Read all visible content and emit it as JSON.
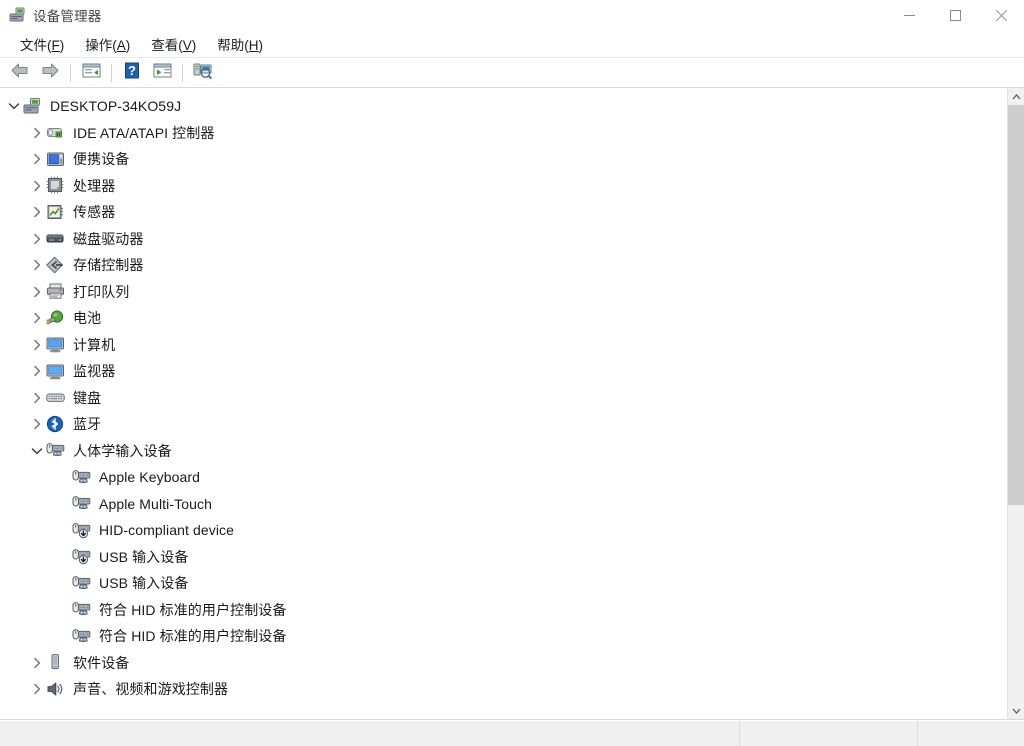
{
  "window": {
    "title": "设备管理器",
    "title_icon": "device-manager-icon",
    "controls": {
      "minimize": "最小化",
      "maximize": "最大化",
      "close": "关闭"
    }
  },
  "menubar": {
    "items": [
      {
        "label": "文件(F)",
        "pre": "文件(",
        "accel": "F",
        "post": ")"
      },
      {
        "label": "操作(A)",
        "pre": "操作(",
        "accel": "A",
        "post": ")"
      },
      {
        "label": "查看(V)",
        "pre": "查看(",
        "accel": "V",
        "post": ")"
      },
      {
        "label": "帮助(H)",
        "pre": "帮助(",
        "accel": "H",
        "post": ")"
      }
    ]
  },
  "toolbar": {
    "buttons": [
      {
        "name": "back-arrow-icon",
        "tooltip": "后退"
      },
      {
        "name": "forward-arrow-icon",
        "tooltip": "前进"
      },
      {
        "name": "show-hide-console-tree-icon",
        "tooltip": "显示/隐藏控制台树"
      },
      {
        "name": "help-icon",
        "tooltip": "帮助"
      },
      {
        "name": "properties-icon",
        "tooltip": "属性"
      },
      {
        "name": "scan-hardware-changes-icon",
        "tooltip": "扫描检测硬件改动"
      }
    ]
  },
  "tree": {
    "root": {
      "label": "DESKTOP-34KO59J",
      "icon": "computer-root-icon",
      "expanded": true
    },
    "items": [
      {
        "label": "IDE ATA/ATAPI 控制器",
        "icon": "ide-controller-icon",
        "level": 1,
        "expanded": false
      },
      {
        "label": "便携设备",
        "icon": "portable-device-icon",
        "level": 1,
        "expanded": false
      },
      {
        "label": "处理器",
        "icon": "processor-icon",
        "level": 1,
        "expanded": false
      },
      {
        "label": "传感器",
        "icon": "sensor-icon",
        "level": 1,
        "expanded": false
      },
      {
        "label": "磁盘驱动器",
        "icon": "disk-drive-icon",
        "level": 1,
        "expanded": false
      },
      {
        "label": "存储控制器",
        "icon": "storage-controller-icon",
        "level": 1,
        "expanded": false
      },
      {
        "label": "打印队列",
        "icon": "print-queue-icon",
        "level": 1,
        "expanded": false
      },
      {
        "label": "电池",
        "icon": "battery-icon",
        "level": 1,
        "expanded": false
      },
      {
        "label": "计算机",
        "icon": "computer-icon",
        "level": 1,
        "expanded": false
      },
      {
        "label": "监视器",
        "icon": "monitor-icon",
        "level": 1,
        "expanded": false
      },
      {
        "label": "键盘",
        "icon": "keyboard-icon",
        "level": 1,
        "expanded": false
      },
      {
        "label": "蓝牙",
        "icon": "bluetooth-icon",
        "level": 1,
        "expanded": false
      },
      {
        "label": "人体学输入设备",
        "icon": "hid-icon",
        "level": 1,
        "expanded": true
      },
      {
        "label": "Apple Keyboard",
        "icon": "hid-device-icon",
        "level": 2,
        "expanded": null
      },
      {
        "label": "Apple Multi-Touch",
        "icon": "hid-device-icon",
        "level": 2,
        "expanded": null
      },
      {
        "label": "HID-compliant device",
        "icon": "hid-device-download-icon",
        "level": 2,
        "expanded": null
      },
      {
        "label": "USB 输入设备",
        "icon": "hid-device-download-icon",
        "level": 2,
        "expanded": null
      },
      {
        "label": "USB 输入设备",
        "icon": "hid-device-icon",
        "level": 2,
        "expanded": null
      },
      {
        "label": "符合 HID 标准的用户控制设备",
        "icon": "hid-device-icon",
        "level": 2,
        "expanded": null
      },
      {
        "label": "符合 HID 标准的用户控制设备",
        "icon": "hid-device-icon",
        "level": 2,
        "expanded": null
      },
      {
        "label": "软件设备",
        "icon": "software-device-icon",
        "level": 1,
        "expanded": false
      },
      {
        "label": "声音、视频和游戏控制器",
        "icon": "sound-video-game-icon",
        "level": 1,
        "expanded": false
      }
    ]
  },
  "scrollbar": {
    "up_arrow": "向上滚动",
    "down_arrow": "向下滚动",
    "thumb_position_percent": 0,
    "thumb_size_percent": 67
  },
  "statusbar": {
    "panes": [
      "",
      "",
      ""
    ]
  }
}
